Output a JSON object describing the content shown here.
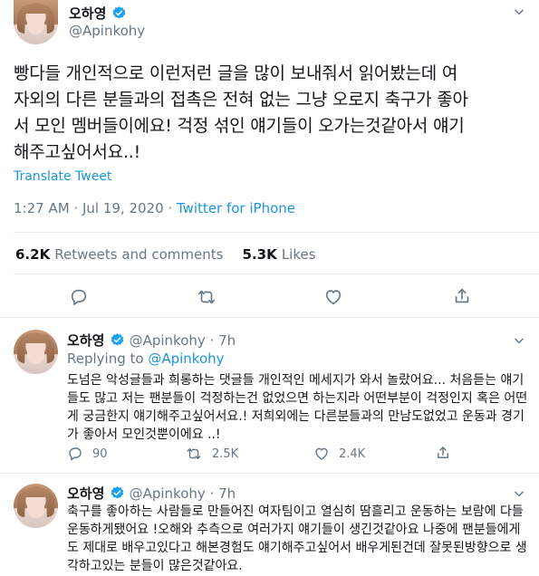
{
  "tweet": {
    "author_name": "오하영",
    "author_handle": "@Apinkohy",
    "text_lines": [
      "빵다들 개인적으로 이런저런 글을 많이 보내줘서 읽어봤는데 여",
      "자외의 다른 분들과의 접촉은 전혀 없는 그냥 오로지 축구가 좋아",
      "서 모인 멤버들이에요! 걱정 섞인 얘기들이 오가는것같아서 얘기",
      "해주고싶어서요..!"
    ],
    "translate_label": "Translate Tweet",
    "time": "1:27 AM · Jul 19, 2020 · ",
    "source": "Twitter for iPhone",
    "retweets_count": "6.2K",
    "retweets_label": "Retweets and comments",
    "likes_count": "5.3K",
    "likes_label": "Likes"
  },
  "replies": [
    {
      "author_name": "오하영",
      "author_handle": "@Apinkohy · 7h",
      "replying_prefix": "Replying to ",
      "replying_handle": "@Apinkohy",
      "text_lines": [
        "도넘은 악성글들과 희롱하는 댓글들 개인적인 메세지가 와서 놀랐어요... 처음듣는 얘기",
        "들도 많고 저는 팬분들이 걱정하는건 없었으면 하는지라 어떤부분이 걱정인지 혹은 어떤",
        "게 궁금한지 얘기해주고싶어서요.! 저희외에는 다른분들과의 만남도없었고 운동과 경기",
        "가 좋아서 모인것뿐이에요 ..!"
      ],
      "reply_count": "90",
      "retweet_count": "2.5K",
      "like_count": "2.4K"
    },
    {
      "author_name": "오하영",
      "author_handle": "@Apinkohy · 7h",
      "text_lines": [
        "축구를 좋아하는 사람들로 만들어진 여자팀이고 열심히 땀흘리고 운동하는 보람에 다들",
        "운동하게됐어요 !오해와 추측으로 여러가지 얘기들이 생긴것같아요 나중에 팬분들에게",
        "도 제대로 배우고있다고 해본경험도 얘기해주고싶어서 배우게된건데 잘못된방향으로 생",
        "각하고있는 분들이 많은것같아요."
      ]
    }
  ],
  "icons": {
    "verified": "verified-badge-icon",
    "caret": "chevron-down-icon",
    "reply": "reply-icon",
    "retweet": "retweet-icon",
    "like": "heart-icon",
    "share": "share-icon"
  },
  "colors": {
    "accent": "#1da1f2",
    "link": "#1b95e0",
    "muted": "#657786",
    "divider": "#e6ecf0"
  }
}
